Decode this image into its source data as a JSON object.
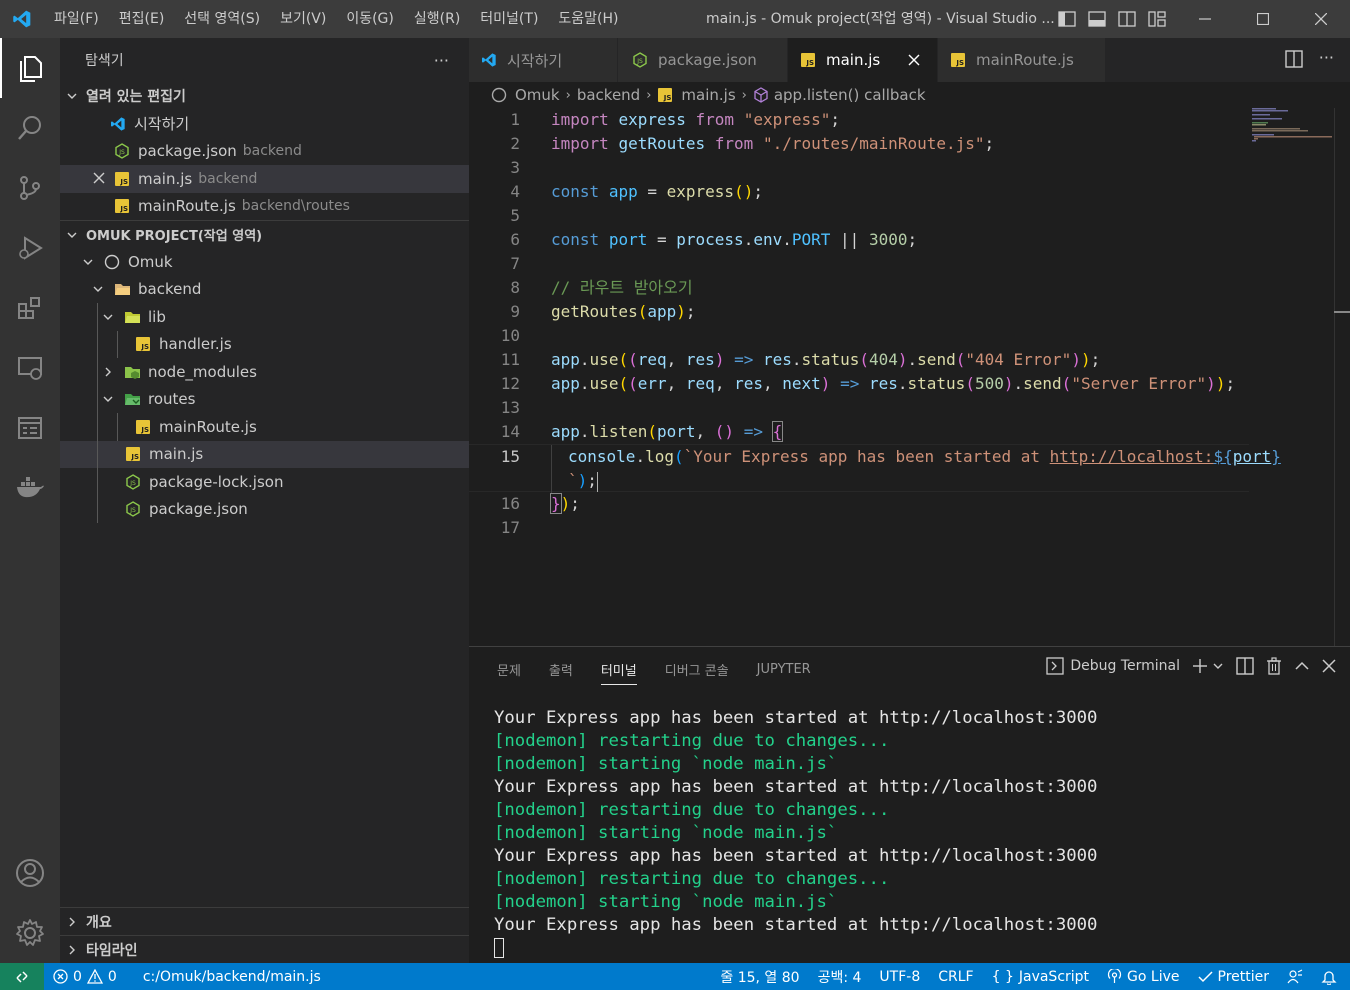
{
  "titlebar": {
    "menu": [
      "파일(F)",
      "편집(E)",
      "선택 영역(S)",
      "보기(V)",
      "이동(G)",
      "실행(R)",
      "터미널(T)",
      "도움말(H)"
    ],
    "window_title": "main.js - Omuk project(작업 영역) - Visual Studio ..."
  },
  "sidebar": {
    "title": "탐색기",
    "more": "···",
    "open_editors": {
      "label": "열려 있는 편집기",
      "items": [
        {
          "name": "시작하기",
          "desc": ""
        },
        {
          "name": "package.json",
          "desc": "backend"
        },
        {
          "name": "main.js",
          "desc": "backend"
        },
        {
          "name": "mainRoute.js",
          "desc": "backend\\routes"
        }
      ]
    },
    "workspace": {
      "label": "OMUK PROJECT(작업 영역)",
      "tree": [
        {
          "name": "Omuk"
        },
        {
          "name": "backend"
        },
        {
          "name": "lib"
        },
        {
          "name": "handler.js"
        },
        {
          "name": "node_modules"
        },
        {
          "name": "routes"
        },
        {
          "name": "mainRoute.js"
        },
        {
          "name": "main.js"
        },
        {
          "name": "package-lock.json"
        },
        {
          "name": "package.json"
        }
      ]
    },
    "outline": "개요",
    "timeline": "타임라인"
  },
  "tabs": [
    {
      "label": "시작하기",
      "icon": "vscode-icon"
    },
    {
      "label": "package.json",
      "icon": "nodejs-icon"
    },
    {
      "label": "main.js",
      "icon": "js-icon",
      "active": true
    },
    {
      "label": "mainRoute.js",
      "icon": "js-icon"
    }
  ],
  "breadcrumb": [
    "Omuk",
    "backend",
    "main.js",
    "app.listen() callback"
  ],
  "code": {
    "line_numbers": [
      "1",
      "2",
      "3",
      "4",
      "5",
      "6",
      "7",
      "8",
      "9",
      "10",
      "11",
      "12",
      "13",
      "14",
      "15",
      "",
      "16",
      "17"
    ],
    "l1": {
      "import": "import",
      "name": "express",
      "from": "from",
      "src": "\"express\""
    },
    "l2": {
      "import": "import",
      "name": "getRoutes",
      "from": "from",
      "src": "\"./routes/mainRoute.js\""
    },
    "l4": {
      "const": "const",
      "name": "app",
      "call": "express"
    },
    "l6": {
      "const": "const",
      "name": "port",
      "obj": "process",
      "env": "env",
      "PORT": "PORT",
      "or": "||",
      "num": "3000"
    },
    "l8": {
      "comment": "// 라우트 받아오기"
    },
    "l9": {
      "fn": "getRoutes",
      "arg": "app"
    },
    "l11": {
      "app": "app",
      "use": "use",
      "req": "req",
      "res": "res",
      "res2": "res",
      "status": "status",
      "code": "404",
      "send": "send",
      "msg": "\"404 Error\""
    },
    "l12": {
      "app": "app",
      "use": "use",
      "err": "err",
      "req": "req",
      "res": "res",
      "next": "next",
      "res2": "res",
      "status": "status",
      "code": "500",
      "send": "send",
      "msg": "\"Server Error\""
    },
    "l14": {
      "app": "app",
      "listen": "listen",
      "port": "port"
    },
    "l15": {
      "console": "console",
      "log": "log",
      "str": "`Your Express app has been started at ",
      "url": "http://localhost:",
      "interp_open": "${",
      "interp_var": "port",
      "interp_close": "}"
    },
    "l15b": {
      "str": "`"
    }
  },
  "panel": {
    "tabs": [
      "문제",
      "출력",
      "터미널",
      "디버그 콘솔",
      "JUPYTER"
    ],
    "active_tab": "터미널",
    "debug_terminal": "Debug Terminal"
  },
  "terminal": {
    "lines": [
      {
        "text": "Your Express app has been started at http://localhost:3000",
        "type": "w"
      },
      {
        "text": "[nodemon] restarting due to changes...",
        "type": "g"
      },
      {
        "text": "[nodemon] starting `node main.js`",
        "type": "g"
      },
      {
        "text": "Your Express app has been started at http://localhost:3000",
        "type": "w"
      },
      {
        "text": "[nodemon] restarting due to changes...",
        "type": "g"
      },
      {
        "text": "[nodemon] starting `node main.js`",
        "type": "g"
      },
      {
        "text": "Your Express app has been started at http://localhost:3000",
        "type": "w"
      },
      {
        "text": "[nodemon] restarting due to changes...",
        "type": "g"
      },
      {
        "text": "[nodemon] starting `node main.js`",
        "type": "g"
      },
      {
        "text": "Your Express app has been started at http://localhost:3000",
        "type": "w"
      }
    ]
  },
  "statusbar": {
    "errors": "0",
    "warnings": "0",
    "path": "c:/Omuk/backend/main.js",
    "position": "줄 15, 열 80",
    "spaces": "공백: 4",
    "encoding": "UTF-8",
    "eol": "CRLF",
    "language": "JavaScript",
    "golive": "Go Live",
    "prettier": "Prettier"
  },
  "colors": {
    "accent": "#007acc",
    "remote": "#16825d",
    "js_icon": "#e8c437",
    "node_green": "#8cc84b"
  }
}
